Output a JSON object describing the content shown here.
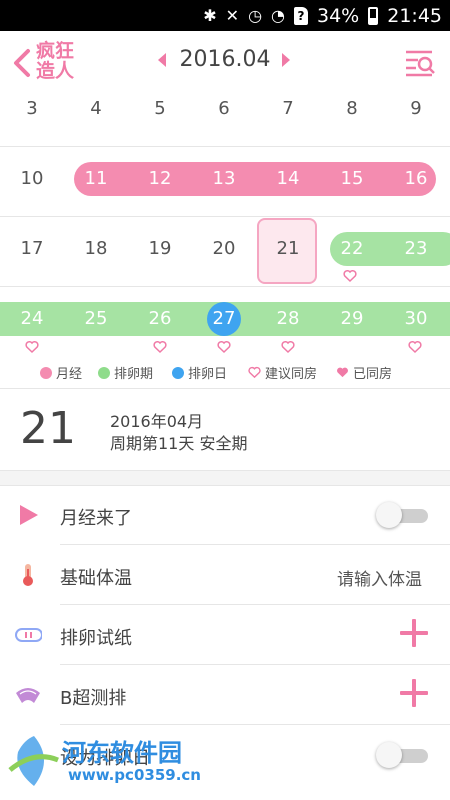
{
  "status_bar": {
    "battery": "34%",
    "time": "21:45",
    "sim_glyph": "?"
  },
  "header": {
    "logo_line1": "疯狂",
    "logo_line2": "造人",
    "month": "2016.04"
  },
  "calendar": {
    "weeks": [
      [
        "3",
        "4",
        "5",
        "6",
        "7",
        "8",
        "9"
      ],
      [
        "10",
        "11",
        "12",
        "13",
        "14",
        "15",
        "16"
      ],
      [
        "17",
        "18",
        "19",
        "20",
        "21",
        "22",
        "23"
      ],
      [
        "24",
        "25",
        "26",
        "27",
        "28",
        "29",
        "30"
      ]
    ],
    "selected_day": "21",
    "ovulation_day": "27",
    "colors": {
      "period": "#f48cb0",
      "ovulation": "#a6e3a3",
      "ovulation_day": "#3fa4f0",
      "heart": "#f07aa6"
    }
  },
  "legend": {
    "period": "月经",
    "ovulation_period": "排卵期",
    "ovulation_day": "排卵日",
    "suggested": "建议同房",
    "done": "已同房"
  },
  "info": {
    "day": "21",
    "date": "2016年04月",
    "desc": "周期第11天 安全期"
  },
  "settings": {
    "period_label": "月经来了",
    "temp_label": "基础体温",
    "temp_placeholder": "请输入体温",
    "ovulation_test_label": "排卵试纸",
    "bultrasound_label": "B超测排",
    "set_ovulation_label": "设为排卵日"
  },
  "watermark": {
    "title": "河东软件园",
    "url": "www.pc0359.cn"
  }
}
